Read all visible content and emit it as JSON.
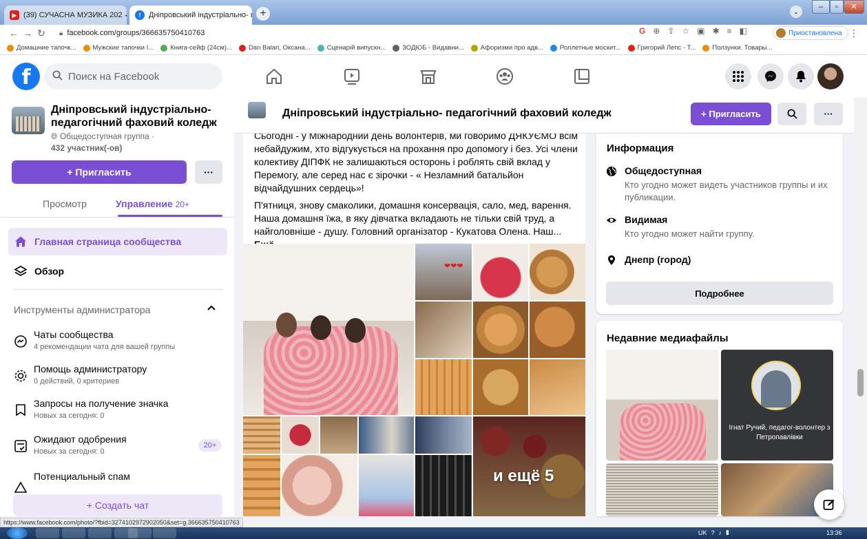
{
  "browser": {
    "tabs": [
      {
        "title": "(39) СУЧАСНА МУЗИКА 202",
        "audio": "◀︎",
        "active": false
      },
      {
        "title": "Дніпровський індустріально- п",
        "active": true
      }
    ],
    "url": "facebook.com/groups/366635750410763",
    "profile_status": "Приостановлена",
    "bookmarks": [
      {
        "label": "Домашние тапочк...",
        "color": "#f28b00"
      },
      {
        "label": "Мужские тапочки I...",
        "color": "#f28b00"
      },
      {
        "label": "Книга-сейф (24см)...",
        "color": "#4caf50"
      },
      {
        "label": "Dan Balan, Оксана...",
        "color": "#e0201c"
      },
      {
        "label": "Сценарій випускн...",
        "color": "#4db6ac"
      },
      {
        "label": "ЗОДЮБ - Видавни...",
        "color": "#5f6368"
      },
      {
        "label": "Афоризми про адв...",
        "color": "#c0a000"
      },
      {
        "label": "Роллетные москит...",
        "color": "#1e88e5"
      },
      {
        "label": "Григорий Лепс - Т...",
        "color": "#e0201c"
      },
      {
        "label": "Ползунки. Товары...",
        "color": "#f28b00"
      }
    ]
  },
  "fb": {
    "search_placeholder": "Поиск на Facebook"
  },
  "group": {
    "name": "Дніпровський індустріально- педагогічний фаховий коледж",
    "privacy": "Общедоступная группа ·",
    "members": "432 участник(-ов)",
    "invite_label": "+ Пригласить",
    "tabs": {
      "view": "Просмотр",
      "manage": "Управление",
      "manage_count": "20+"
    },
    "nav": {
      "home": "Главная страница сообщества",
      "overview": "Обзор"
    },
    "admin_tools_title": "Инструменты администратора",
    "tools": [
      {
        "title": "Чаты сообщества",
        "sub": "4 рекомендации чата для вашей группы"
      },
      {
        "title": "Помощь администратору",
        "sub": "0 действий, 0 критериев"
      },
      {
        "title": "Запросы на получение значка",
        "sub": "Новых за сегодня: 0"
      },
      {
        "title": "Ожидают одобрения",
        "sub": "Новых за сегодня: 0",
        "badge": "20+"
      },
      {
        "title": "Потенциальный спам",
        "sub": ""
      }
    ],
    "create_chat": "+ Создать чат"
  },
  "header_bar": {
    "invite": "+ Пригласить"
  },
  "post": {
    "para1": "Сьогодні - у Міжнародний день волонтерів, ми говоримо ДЯКУЄМО всім небайдужим, хто відгукується на прохання про допомогу і без. Усі члени колективу ДІПФК не залишаються осторонь і роблять свій вклад у Перемогу, але серед нас є зірочки - « Незламний батальйон відчайдушних сердець»!",
    "para2": "П'ятниця, знову смаколики, домашня консервація, сало, мед, варення. Наша домашня їжа, в яку дівчатка вкладають не тільки свій труд, а найголовніше - душу. Головний організатор - Кукатова Олена. Наш...",
    "more": "Ещё",
    "more_photos": "и ещё 5"
  },
  "info": {
    "title": "Информация",
    "public_title": "Общедоступная",
    "public_desc": "Кто угодно может видеть участников группы и их публикации.",
    "visible_title": "Видимая",
    "visible_desc": "Кто угодно может найти группу.",
    "location": "Днепр (город)",
    "details": "Подробнее"
  },
  "media": {
    "title": "Недавние медиафайлы",
    "caption2": "Ігнат Ручий, педагог-волонтер з Петропавлівки"
  },
  "status_url": "https://www.facebook.com/photo/?fbid=3274102972902050&set=g.366635750410763",
  "taskbar": {
    "lang": "UK",
    "clock": "13:36"
  },
  "colors": {
    "accent": "#7b4fd3",
    "fb_blue": "#1877f2"
  }
}
